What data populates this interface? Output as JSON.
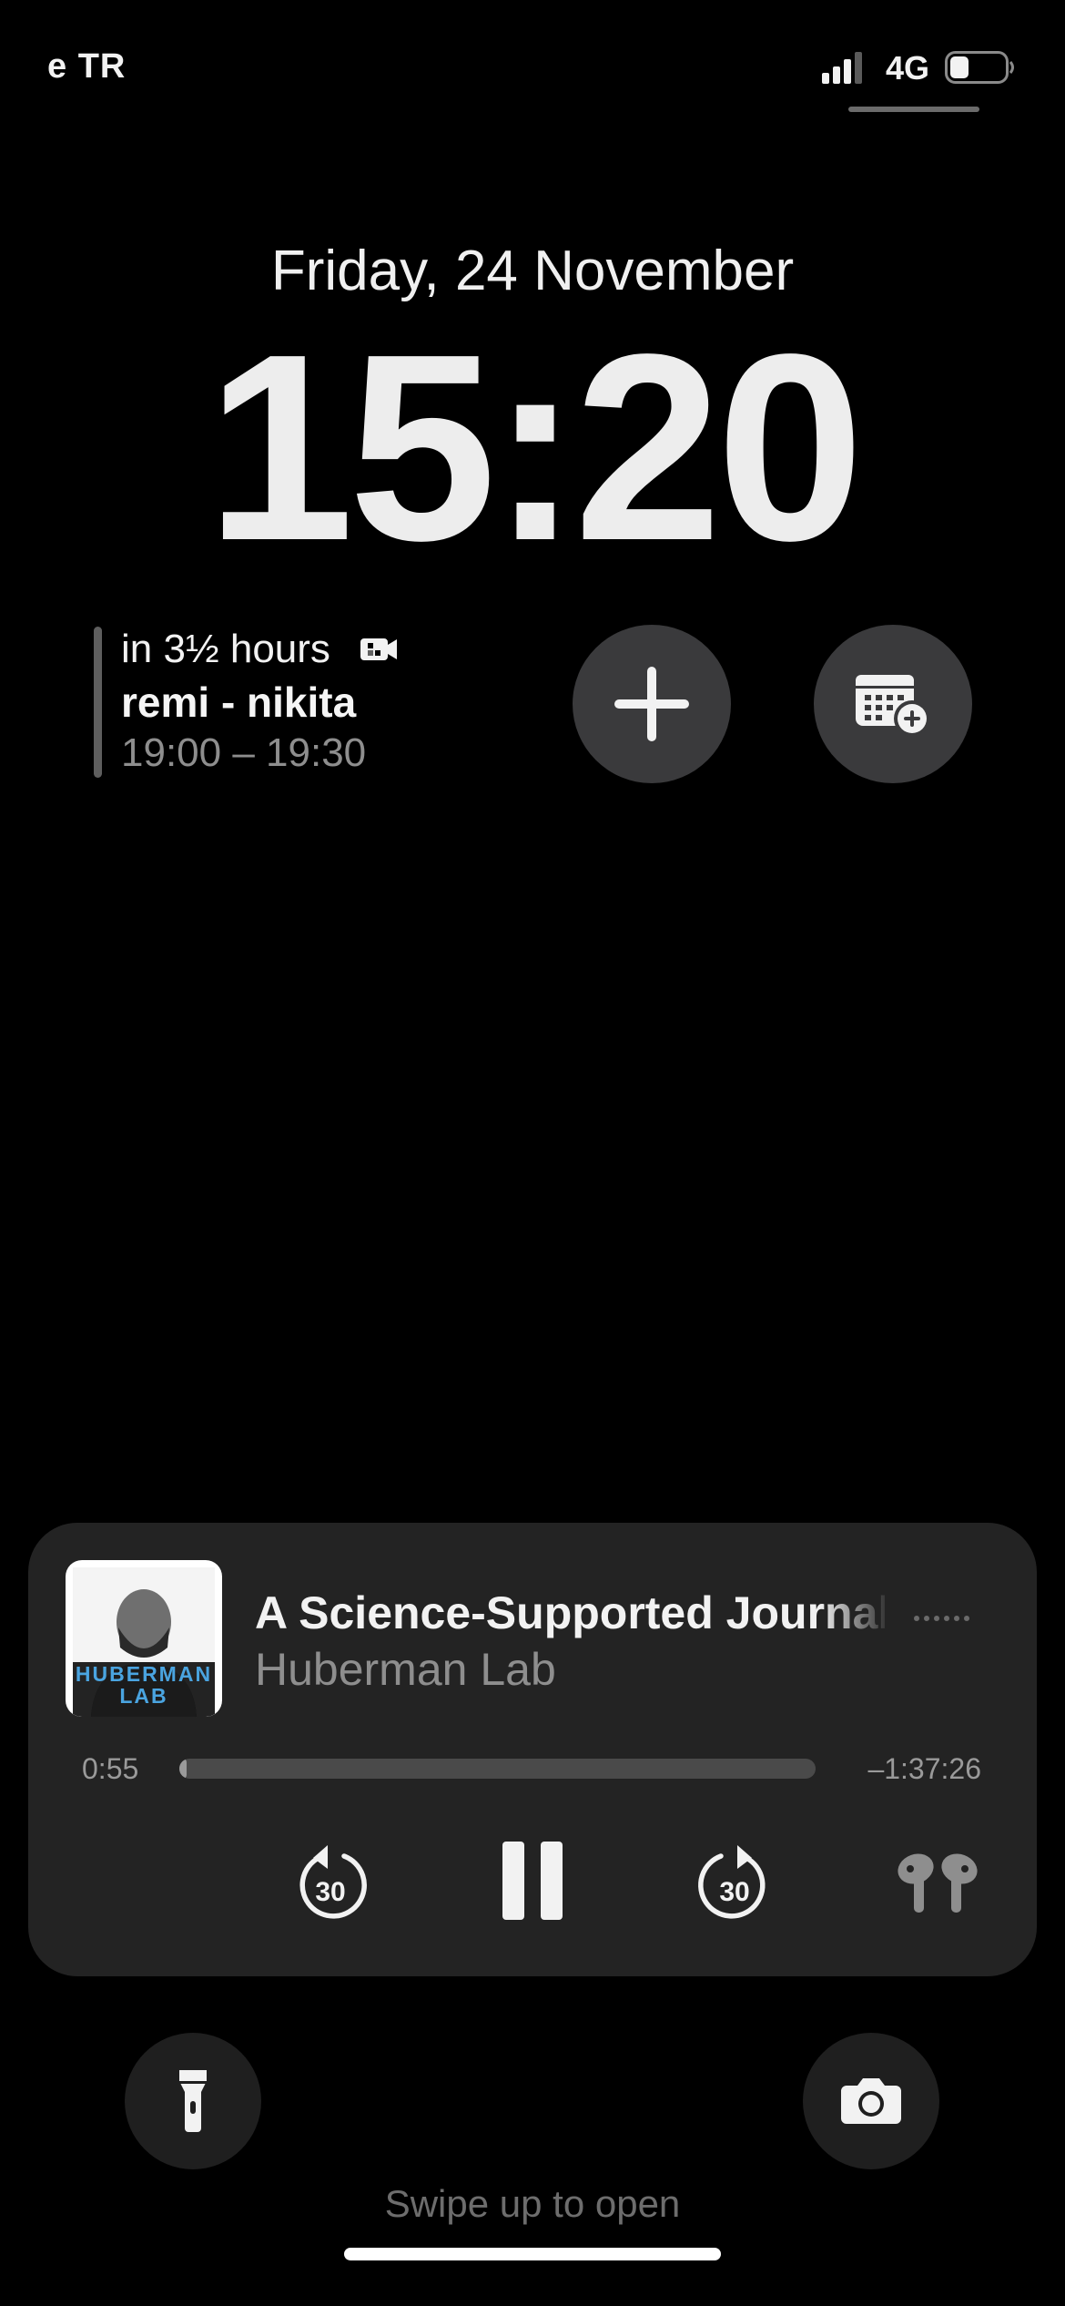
{
  "status_bar": {
    "carrier": "e TR",
    "network": "4G",
    "battery_level": 0.35
  },
  "lock": {
    "date": "Friday, 24 November",
    "time": "15:20"
  },
  "calendar_widget": {
    "when": "in 3½ hours",
    "title": "remi - nikita",
    "time_range": "19:00 – 19:30",
    "icon": "video-camera-icon"
  },
  "shortcuts": {
    "add_icon": "plus-icon",
    "calendar_icon": "calendar-add-icon"
  },
  "now_playing": {
    "title": "A Science-Supported Journal",
    "artist": "Huberman Lab",
    "artwork_text_line1": "HUBERMAN",
    "artwork_text_line2": "LAB",
    "elapsed": "0:55",
    "remaining": "–1:37:26",
    "progress": 0.01,
    "skip_back_seconds": "30",
    "skip_forward_seconds": "30",
    "output_icon": "airpods-icon"
  },
  "bottom": {
    "flashlight_icon": "flashlight-icon",
    "camera_icon": "camera-icon",
    "swipe_hint": "Swipe up to open"
  }
}
